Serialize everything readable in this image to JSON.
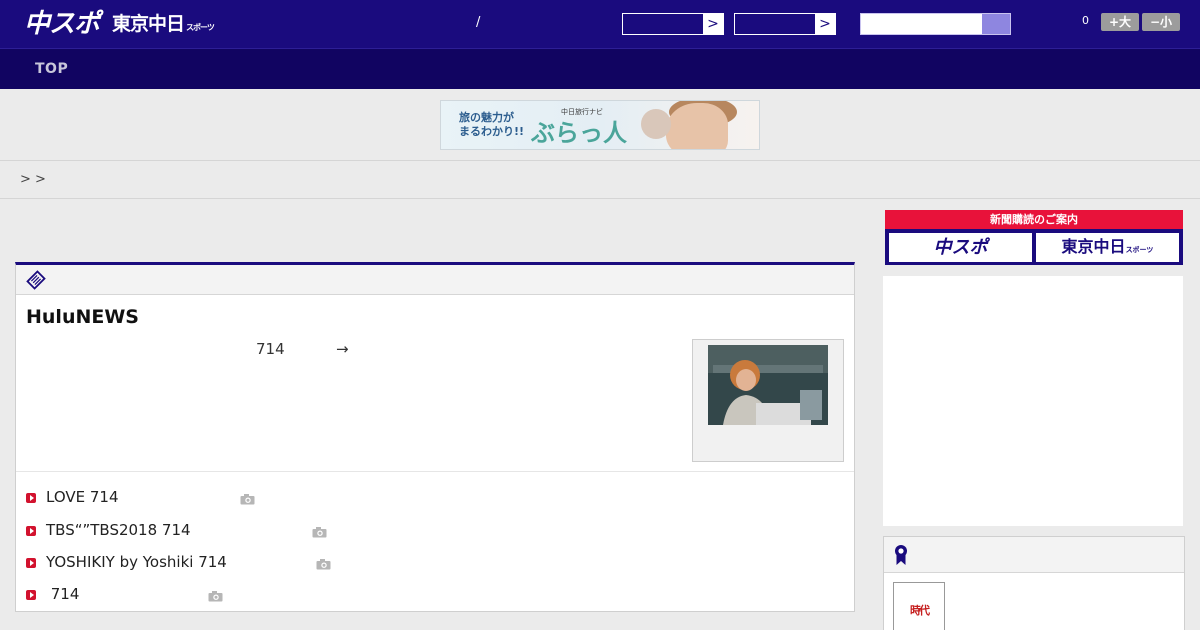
{
  "header": {
    "logo_primary": "中スポ",
    "logo_secondary": "東京中日",
    "logo_secondary_small": "スポーツ",
    "separator": "/",
    "select1_arrow": ">",
    "select2_arrow": ">",
    "font_count": "0",
    "font_larger": "+大",
    "font_smaller": "−小"
  },
  "nav": {
    "top": "TOP"
  },
  "banner": {
    "line1": "旅の魅力が",
    "line2": "まるわかり!!",
    "brand_small": "中日旅行ナビ",
    "brand": "ぶらっ人"
  },
  "breadcrumb": "> >",
  "article": {
    "headline": "HuluNEWS",
    "lead_number": "714",
    "lead_arrow": "→",
    "news": [
      {
        "text": "LOVE 714"
      },
      {
        "text": "TBS“”TBS2018  714"
      },
      {
        "text": "YOSHIKIY by Yoshiki 714"
      },
      {
        "text": " 714"
      }
    ]
  },
  "sidebar": {
    "subscription_title": "新聞購読のご案内",
    "subscription_chuspo": "中スポ",
    "subscription_tokyo": "東京中日",
    "subscription_tokyo_small": "スポーツ",
    "rank_thumb_text": "時",
    "rank_thumb_accent": "代"
  },
  "colors": {
    "brand_navy": "#1a0b7e",
    "nav_dark": "#110461",
    "accent_red": "#e8123a",
    "bullet_red": "#d2122e"
  }
}
